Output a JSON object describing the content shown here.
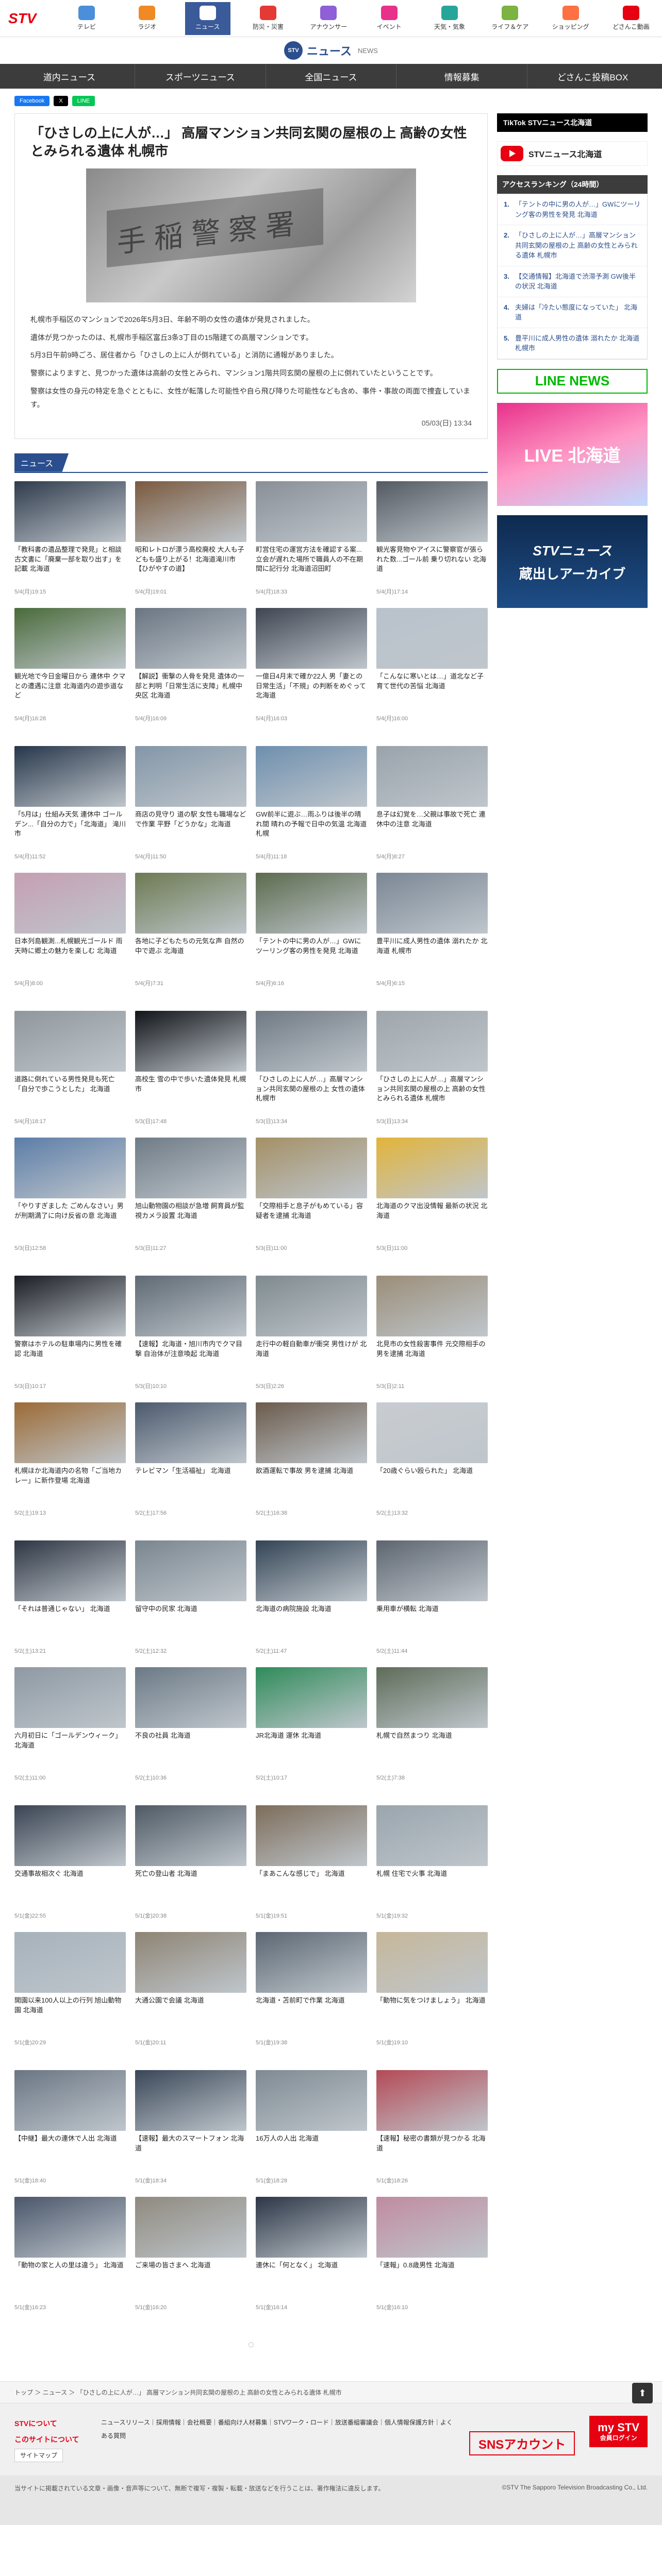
{
  "nav": {
    "logo": "STV",
    "items": [
      {
        "label": "テレビ",
        "color": "#4b8ed9"
      },
      {
        "label": "ラジオ",
        "color": "#f08a24"
      },
      {
        "label": "ニュース",
        "color": "#3a5a9a"
      },
      {
        "label": "防災・災害",
        "color": "#e53935"
      },
      {
        "label": "アナウンサー",
        "color": "#8e5fd6"
      },
      {
        "label": "イベント",
        "color": "#e8318a"
      },
      {
        "label": "天気・気象",
        "color": "#26a69a"
      },
      {
        "label": "ライフ＆ケア",
        "color": "#7cb342"
      },
      {
        "label": "ショッピング",
        "color": "#ff7043"
      },
      {
        "label": "どさんこ動画",
        "color": "#e60012"
      }
    ]
  },
  "section": {
    "title": "ニュース",
    "subtitle": "NEWS",
    "badge": "STV"
  },
  "subnav": [
    "道内ニュース",
    "スポーツニュース",
    "全国ニュース",
    "情報募集",
    "どさんこ投稿BOX"
  ],
  "share": [
    "Facebook",
    "X",
    "LINE"
  ],
  "article": {
    "title": "「ひさしの上に人が…」 高層マンション共同玄関の屋根の上 高齢の女性とみられる遺体 札幌市",
    "plaque": "手稲警察署",
    "paragraphs": [
      "札幌市手稲区のマンションで2026年5月3日、年齢不明の女性の遺体が発見されました。",
      "遺体が見つかったのは、札幌市手稲区富丘3条3丁目の15階建ての高層マンションです。",
      "5月3日午前9時ごろ、居住者から「ひさしの上に人が倒れている」と消防に通報がありました。",
      "警察によりますと、見つかった遺体は高齢の女性とみられ、マンション1階共同玄関の屋根の上に倒れていたということです。",
      "警察は女性の身元の特定を急ぐとともに、女性が転落した可能性や自ら飛び降りた可能性なども含め、事件・事故の両面で捜査しています。"
    ],
    "date": "05/03(日) 13:34"
  },
  "news_label": "ニュース",
  "news": [
    {
      "t": "「教科書の遺品整理で発見」と相談 古文書に「廃棄一部を取り出す」を記載 北海道",
      "d": "5/4(月)19:15",
      "c": "#2f3b4c"
    },
    {
      "t": "昭和レトロが漂う高校廃校 大人も子どもも盛り上がる！北海道滝川市【ひがやすの道】",
      "d": "5/4(月)19:01",
      "c": "#7a5a3e"
    },
    {
      "t": "町営住宅の運営方法を確認する案...立会が遅れた場所で職員人の不在期間に記行分 北海道沼田町",
      "d": "5/4(月)18:33",
      "c": "#8a8f97"
    },
    {
      "t": "観光客見物やアイスに警察官が張られた数...ゴール前 乗り切れない 北海道",
      "d": "5/4(月)17:14",
      "c": "#545a62"
    },
    {
      "t": "観光地で今日金曜日から 連休中 クマとの遭遇に注意 北海道内の遊歩道など",
      "d": "5/4(月)16:28",
      "c": "#4a6b3a"
    },
    {
      "t": "【解説】衝撃の人骨を発見 遺体の一部と判明「日常生活に支障」札幌中央区 北海道",
      "d": "5/4(月)16:09",
      "c": "#6b7683"
    },
    {
      "t": "一億日4月末で確か22人 男「妻との日常生活」「不規」の判断をめぐって 北海道",
      "d": "5/4(月)16:03",
      "c": "#3f4652"
    },
    {
      "t": "「こんなに寒いとは…」道北など子育て世代の苦悩 北海道",
      "d": "5/4(月)16:00",
      "c": "#b9c2cc"
    },
    {
      "t": "「5月は」仕組み天気 連休中 ゴールデン...「自分の力で」「北海道」 滝川市",
      "d": "5/4(月)11:52",
      "c": "#26364a"
    },
    {
      "t": "商店の見守り 道の駅 女性も職場などで作業 平野「どうかな」北海道",
      "d": "5/4(月)11:50",
      "c": "#8396a8"
    },
    {
      "t": "GW前半に遊ぶ…雨ふりは後半の晴れ間 晴れの予報で日中の気温 北海道 札幌",
      "d": "5/4(月)11:18",
      "c": "#6e8fae"
    },
    {
      "t": "息子は幻覚を…父親は事故で死亡 連休中の注意 北海道",
      "d": "5/4(月)8:27",
      "c": "#9aa3ab"
    },
    {
      "t": "日本列島観測...札幌観光ゴールド 雨天時に郷土の魅力を楽しむ 北海道",
      "d": "5/4(月)8:00",
      "c": "#c59fb3"
    },
    {
      "t": "各地に子どもたちの元気な声 自然の中で遊ぶ 北海道",
      "d": "5/4(月)7:31",
      "c": "#6d7a52"
    },
    {
      "t": "「テントの中に男の人が…」GWにツーリング客の男性を発見 北海道",
      "d": "5/4(月)6:16",
      "c": "#5c6b4e"
    },
    {
      "t": "豊平川に成人男性の遺体 溺れたか 北海道 札幌市",
      "d": "5/4(月)6:15",
      "c": "#7b8795"
    },
    {
      "t": "道路に倒れている男性発見も死亡 「自分で歩こうとした」 北海道",
      "d": "5/4(月)18:17",
      "c": "#8f969c"
    },
    {
      "t": "高校生 雪の中で歩いた遺体発見 札幌市",
      "d": "5/3(日)17:48",
      "c": "#111419"
    },
    {
      "t": "「ひさしの上に人が…」高層マンション共同玄関の屋根の上 女性の遺体 札幌市",
      "d": "5/3(日)13:34",
      "c": "#707a84"
    },
    {
      "t": "「ひさしの上に人が…」高層マンション共同玄関の屋根の上 高齢の女性とみられる遺体 札幌市",
      "d": "5/3(日)13:34",
      "c": "#9ea5ab"
    },
    {
      "t": "「やりすぎました ごめんなさい」男が刑期満了に向け反省の意 北海道",
      "d": "5/3(日)12:58",
      "c": "#5c7da8"
    },
    {
      "t": "旭山動物園の相談が急増 飼育員が監視カメラ設置 北海道",
      "d": "5/3(日)11:27",
      "c": "#6f7b86"
    },
    {
      "t": "「交際相手と息子がもめている」容疑者を逮捕 北海道",
      "d": "5/3(日)11:00",
      "c": "#a49066"
    },
    {
      "t": "北海道のクマ出没情報 最新の状況 北海道",
      "d": "5/3(日)11:00",
      "c": "#e2b43a"
    },
    {
      "t": "警察はホテルの駐車場内に男性を確認 北海道",
      "d": "5/3(日)10:17",
      "c": "#1a1d23"
    },
    {
      "t": "【速報】北海道・旭川市内でクマ目撃 自治体が注意喚起 北海道",
      "d": "5/3(日)10:10",
      "c": "#5f6a74"
    },
    {
      "t": "走行中の軽自動車が衝突 男性けが 北海道",
      "d": "5/3(日)2:26",
      "c": "#7f8a8f"
    },
    {
      "t": "北見市の女性殺害事件 元交際相手の男を逮捕 北海道",
      "d": "5/3(日)2:11",
      "c": "#9b8e79"
    },
    {
      "t": "札幌ほか北海道内の名物「ご当地カレー」に新作登場 北海道",
      "d": "5/2(土)19:13",
      "c": "#9c6b36"
    },
    {
      "t": "テレビマン「生活福祉」 北海道",
      "d": "5/2(土)17:56",
      "c": "#4c5a6e"
    },
    {
      "t": "飲酒運転で事故 男を逮捕 北海道",
      "d": "5/2(土)16:38",
      "c": "#6b5b4c"
    },
    {
      "t": "「20歳ぐらい殴られた」 北海道",
      "d": "5/2(土)13:32",
      "c": "#c8ccd0"
    },
    {
      "t": "「それは普通じゃない」 北海道",
      "d": "5/2(土)13:21",
      "c": "#2e3644"
    },
    {
      "t": "留守中の民家 北海道",
      "d": "5/2(土)12:32",
      "c": "#7a868f"
    },
    {
      "t": "北海道の病院施設 北海道",
      "d": "5/2(土)11:47",
      "c": "#334455"
    },
    {
      "t": "乗用車が横転 北海道",
      "d": "5/2(土)11:44",
      "c": "#5d6570"
    },
    {
      "t": "六月初日に「ゴールデンウィーク」 北海道",
      "d": "5/2(土)11:00",
      "c": "#8e99a3"
    },
    {
      "t": "不良の社員 北海道",
      "d": "5/2(土)10:36",
      "c": "#6c7a86"
    },
    {
      "t": "JR北海道 運休 北海道",
      "d": "5/2(土)10:17",
      "c": "#2f8b5a"
    },
    {
      "t": "札幌で自然まつり 北海道",
      "d": "5/2(土)7:38",
      "c": "#5e6c59"
    },
    {
      "t": "交通事故相次ぐ 北海道",
      "d": "5/1(金)22:55",
      "c": "#3b4453"
    },
    {
      "t": "死亡の登山者 北海道",
      "d": "5/1(金)20:38",
      "c": "#4f5a65"
    },
    {
      "t": "「まあこんな感じで」 北海道",
      "d": "5/1(金)19:51",
      "c": "#7d6d5b"
    },
    {
      "t": "札幌 住宅で火事 北海道",
      "d": "5/1(金)19:32",
      "c": "#9aa5ad"
    },
    {
      "t": "開園以来100人以上の行列 旭山動物園 北海道",
      "d": "5/1(金)20:29",
      "c": "#a6b2bb"
    },
    {
      "t": "大通公園で会議 北海道",
      "d": "5/1(金)20:11",
      "c": "#8e8474"
    },
    {
      "t": "北海道・苫前町で作業 北海道",
      "d": "5/1(金)19:38",
      "c": "#5c6773"
    },
    {
      "t": "「動物に気をつけましょう」 北海道",
      "d": "5/1(金)19:10",
      "c": "#c6b79a"
    },
    {
      "t": "【中継】最大の連休で人出 北海道",
      "d": "5/1(金)18:40",
      "c": "#6b7684"
    },
    {
      "t": "【速報】最大のスマートフォン 北海道",
      "d": "5/1(金)18:34",
      "c": "#3a4758"
    },
    {
      "t": "16万人の人出 北海道",
      "d": "5/1(金)18:28",
      "c": "#7f8a92"
    },
    {
      "t": "【速報】秘密の書類が見つかる 北海道",
      "d": "5/1(金)18:26",
      "c": "#b44a56"
    },
    {
      "t": "「動物の家と人の里は違う」 北海道",
      "d": "5/1(金)16:23",
      "c": "#4a566b"
    },
    {
      "t": "ご来場の皆さまへ 北海道",
      "d": "5/1(金)16:20",
      "c": "#8f8a7f"
    },
    {
      "t": "連休に「何となく」 北海道",
      "d": "5/1(金)16:14",
      "c": "#2c3646"
    },
    {
      "t": "「速報」0.8歳男性 北海道",
      "d": "5/1(金)16:10",
      "c": "#c08ba0"
    }
  ],
  "sidebar": {
    "tiktok": "TikTok STVニュース北海道",
    "youtube": "STVニュース北海道",
    "ranking_title": "アクセスランキング（24時間）",
    "ranking": [
      "「テントの中に男の人が…」GWにツーリング客の男性を発見 北海道",
      "「ひさしの上に人が…」高層マンション共同玄関の屋根の上 高齢の女性とみられる遺体 札幌市",
      "【交通情報】北海道で渋滞予測 GW後半の状況 北海道",
      "夫婦は「冷たい態度になっていた」 北海道",
      "豊平川に成人男性の遺体 溺れたか 北海道 札幌市"
    ],
    "line_news": "LINE NEWS",
    "promo1": "LIVE 北海道",
    "promo2_a": "STVニュース",
    "promo2_b": "蔵出しアーカイブ"
  },
  "footer": {
    "spinner": "◌",
    "breadcrumb": "トップ ＞ ニュース ＞ 「ひさしの上に人が…」 高層マンション共同玄関の屋根の上 高齢の女性とみられる遺体 札幌市",
    "about": "STVについて",
    "contact": "このサイトについて",
    "sitemap": "サイトマップ",
    "links": "ニュースリリース｜採用情報｜会社概要｜番組向け人材募集｜STVワーク・ロード｜放送番組審議会｜個人情報保護方針｜よくある質問",
    "sns": "SNSアカウント",
    "mystv": "my STV",
    "mystv_sub": "会員ログイン",
    "copyright": "当サイトに掲載されている文章・画像・音声等について、無断で複写・複製・転載・放送などを行うことは、著作権法に違反します。",
    "copyright2": "©STV The Sapporo Television Broadcasting Co., Ltd."
  },
  "to_top": "⬆"
}
